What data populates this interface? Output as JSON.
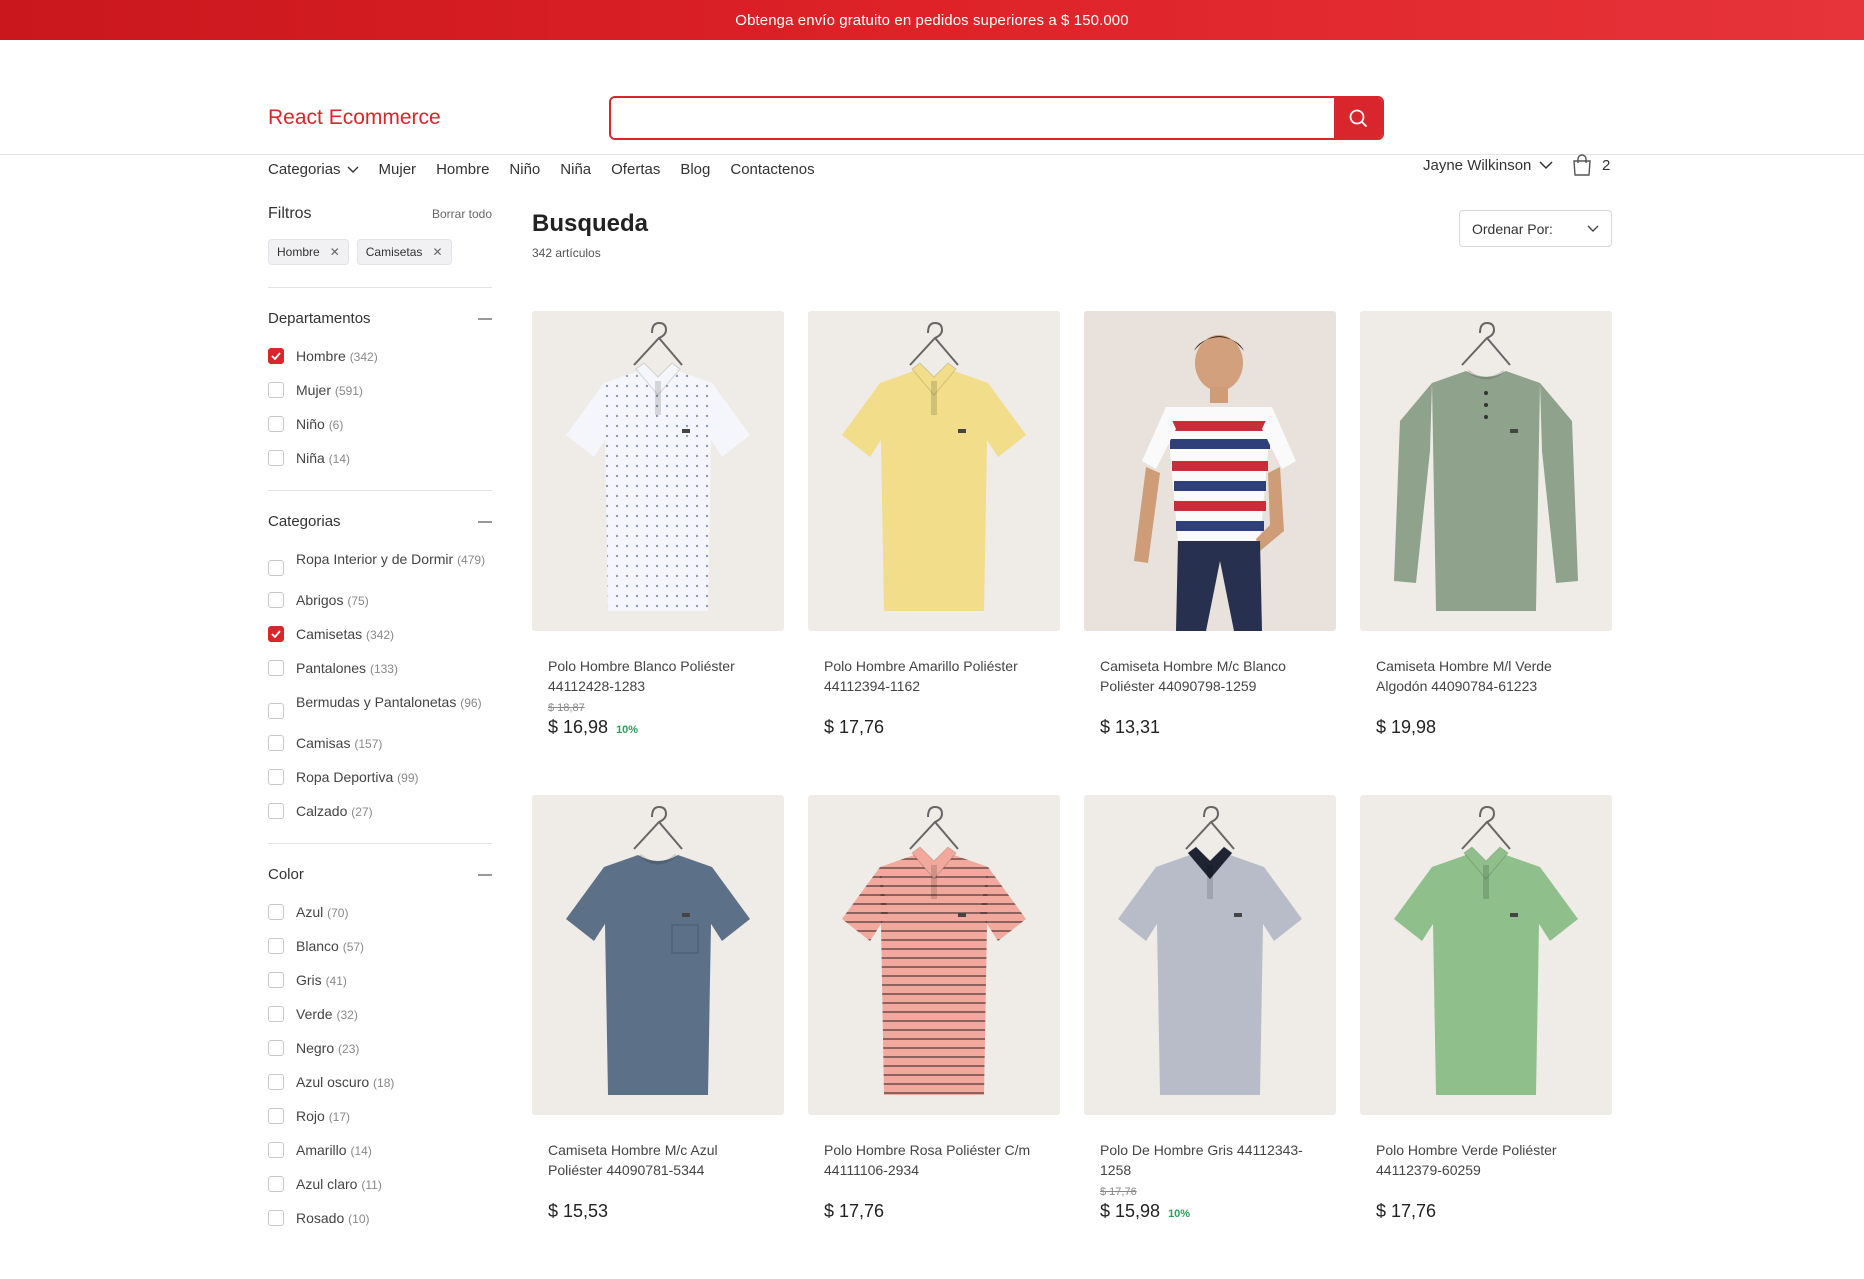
{
  "promo": {
    "text": "Obtenga envío gratuito en pedidos superiores a $ 150.000"
  },
  "header": {
    "logo_part1": "React ",
    "logo_part2": "Ecommerce",
    "search_placeholder": "",
    "nav": [
      "Categorias",
      "Mujer",
      "Hombre",
      "Niño",
      "Niña",
      "Ofertas",
      "Blog",
      "Contactenos"
    ],
    "user_name": "Jayne Wilkinson",
    "cart_count": "2"
  },
  "sidebar": {
    "title": "Filtros",
    "clear_all": "Borrar todo",
    "chips": [
      "Hombre",
      "Camisetas"
    ],
    "groups": [
      {
        "title": "Departamentos",
        "options": [
          {
            "label": "Hombre",
            "count": "(342)",
            "checked": true
          },
          {
            "label": "Mujer",
            "count": "(591)",
            "checked": false
          },
          {
            "label": "Niño",
            "count": "(6)",
            "checked": false
          },
          {
            "label": "Niña",
            "count": "(14)",
            "checked": false
          }
        ]
      },
      {
        "title": "Categorias",
        "options": [
          {
            "label": "Ropa Interior y de Dormir",
            "count": "(479)",
            "checked": false
          },
          {
            "label": "Abrigos",
            "count": "(75)",
            "checked": false
          },
          {
            "label": "Camisetas",
            "count": "(342)",
            "checked": true
          },
          {
            "label": "Pantalones",
            "count": "(133)",
            "checked": false
          },
          {
            "label": "Bermudas y Pantalonetas",
            "count": "(96)",
            "checked": false
          },
          {
            "label": "Camisas",
            "count": "(157)",
            "checked": false
          },
          {
            "label": "Ropa Deportiva",
            "count": "(99)",
            "checked": false
          },
          {
            "label": "Calzado",
            "count": "(27)",
            "checked": false
          }
        ]
      },
      {
        "title": "Color",
        "options": [
          {
            "label": "Azul",
            "count": "(70)",
            "checked": false
          },
          {
            "label": "Blanco",
            "count": "(57)",
            "checked": false
          },
          {
            "label": "Gris",
            "count": "(41)",
            "checked": false
          },
          {
            "label": "Verde",
            "count": "(32)",
            "checked": false
          },
          {
            "label": "Negro",
            "count": "(23)",
            "checked": false
          },
          {
            "label": "Azul oscuro",
            "count": "(18)",
            "checked": false
          },
          {
            "label": "Rojo",
            "count": "(17)",
            "checked": false
          },
          {
            "label": "Amarillo",
            "count": "(14)",
            "checked": false
          },
          {
            "label": "Azul claro",
            "count": "(11)",
            "checked": false
          },
          {
            "label": "Rosado",
            "count": "(10)",
            "checked": false
          }
        ]
      }
    ]
  },
  "main": {
    "title": "Busqueda",
    "items_count": "342 artículos",
    "sort_label": "Ordenar Por:",
    "products": [
      {
        "name": "Polo Hombre Blanco Poliéster 44112428-1283",
        "old_price": "$ 18,87",
        "price": "$ 16,98",
        "discount": "10%",
        "color": "#f4f6fb",
        "kind": "polo",
        "pattern": "dots"
      },
      {
        "name": "Polo Hombre Amarillo Poliéster 44112394-1162",
        "old_price": "",
        "price": "$ 17,76",
        "discount": "",
        "color": "#f1dd8a",
        "kind": "polo",
        "pattern": "none"
      },
      {
        "name": "Camiseta Hombre M/c Blanco Poliéster 44090798-1259",
        "old_price": "",
        "price": "$ 13,31",
        "discount": "",
        "color": "#ffffff",
        "kind": "model",
        "pattern": "stripes"
      },
      {
        "name": "Camiseta Hombre M/l Verde Algodón 44090784-61223",
        "old_price": "",
        "price": "$ 19,98",
        "discount": "",
        "color": "#8fa28c",
        "kind": "henley",
        "pattern": "none"
      },
      {
        "name": "Camiseta Hombre M/c Azul Poliéster 44090781-5344",
        "old_price": "",
        "price": "$ 15,53",
        "discount": "",
        "color": "#5c7188",
        "kind": "tee",
        "pattern": "none"
      },
      {
        "name": "Polo Hombre Rosa Poliéster C/m 44111106-2934",
        "old_price": "",
        "price": "$ 17,76",
        "discount": "",
        "color": "#f2a89c",
        "kind": "polo",
        "pattern": "hstripes"
      },
      {
        "name": "Polo De Hombre Gris 44112343-1258",
        "old_price": "$ 17,76",
        "price": "$ 15,98",
        "discount": "10%",
        "color": "#b8bcc8",
        "kind": "polo-dark-collar",
        "pattern": "none"
      },
      {
        "name": "Polo Hombre Verde Poliéster 44112379-60259",
        "old_price": "",
        "price": "$ 17,76",
        "discount": "",
        "color": "#8fbf8a",
        "kind": "polo",
        "pattern": "none"
      }
    ]
  }
}
